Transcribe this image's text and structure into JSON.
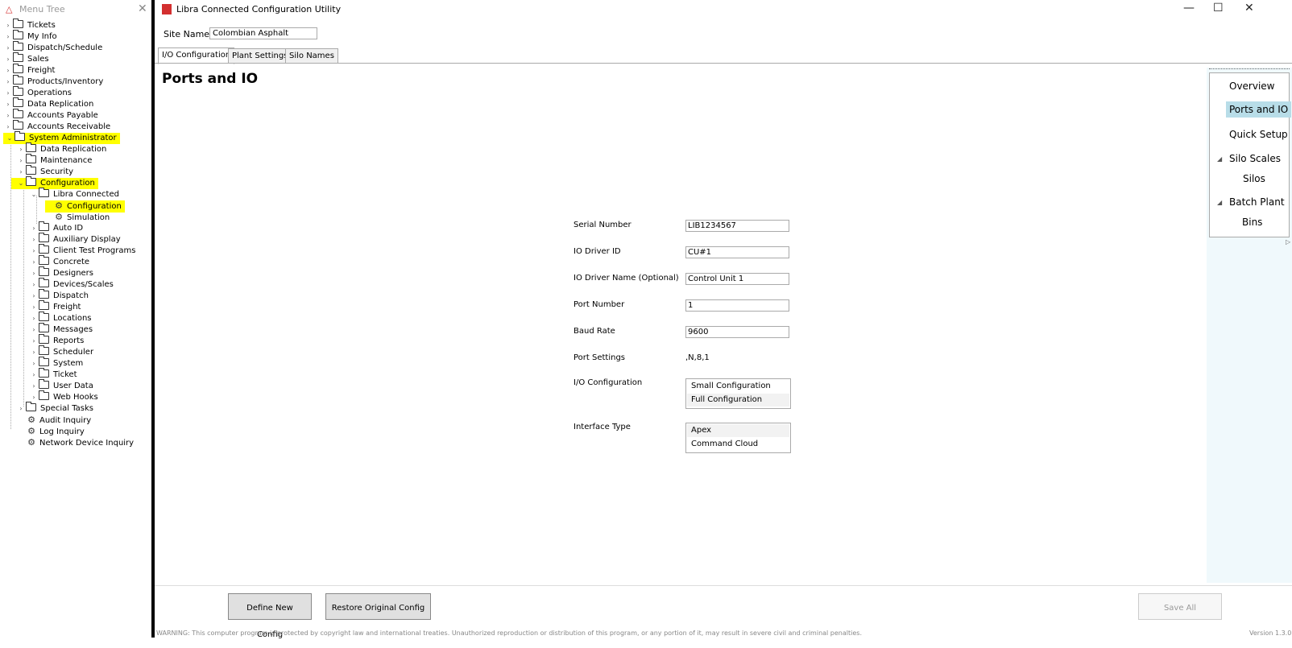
{
  "tree": {
    "title": "Menu Tree",
    "items": [
      {
        "label": "Tickets"
      },
      {
        "label": "My Info"
      },
      {
        "label": "Dispatch/Schedule"
      },
      {
        "label": "Sales"
      },
      {
        "label": "Freight"
      },
      {
        "label": "Products/Inventory"
      },
      {
        "label": "Operations"
      },
      {
        "label": "Data Replication"
      },
      {
        "label": "Accounts Payable"
      },
      {
        "label": "Accounts Receivable"
      },
      {
        "label": "System Administrator"
      },
      {
        "label": "Data Replication"
      },
      {
        "label": "Maintenance"
      },
      {
        "label": "Security"
      },
      {
        "label": "Configuration"
      },
      {
        "label": "Libra Connected"
      },
      {
        "label": "Configuration"
      },
      {
        "label": "Simulation"
      },
      {
        "label": "Auto ID"
      },
      {
        "label": "Auxiliary Display"
      },
      {
        "label": "Client Test Programs"
      },
      {
        "label": "Concrete"
      },
      {
        "label": "Designers"
      },
      {
        "label": "Devices/Scales"
      },
      {
        "label": "Dispatch"
      },
      {
        "label": "Freight"
      },
      {
        "label": "Locations"
      },
      {
        "label": "Messages"
      },
      {
        "label": "Reports"
      },
      {
        "label": "Scheduler"
      },
      {
        "label": "System"
      },
      {
        "label": "Ticket"
      },
      {
        "label": "User Data"
      },
      {
        "label": "Web Hooks"
      },
      {
        "label": "Special Tasks"
      },
      {
        "label": "Audit Inquiry"
      },
      {
        "label": "Log Inquiry"
      },
      {
        "label": "Network Device Inquiry"
      }
    ]
  },
  "window": {
    "title": "Libra Connected Configuration Utility",
    "app_icon_text": "Libra"
  },
  "site": {
    "label": "Site Name",
    "value": "Colombian Asphalt"
  },
  "tabs": [
    {
      "label": "I/O Configuration",
      "active": true
    },
    {
      "label": "Plant Settings"
    },
    {
      "label": "Silo Names"
    }
  ],
  "page": {
    "heading": "Ports and IO"
  },
  "nav": {
    "items": [
      {
        "label": "Overview"
      },
      {
        "label": "Ports and IO",
        "selected": true
      },
      {
        "label": "Quick Setup"
      },
      {
        "label": "Silo Scales"
      },
      {
        "label": "Silos"
      },
      {
        "label": "Batch Plant"
      },
      {
        "label": "Bins"
      }
    ]
  },
  "form": {
    "serial_number": {
      "label": "Serial Number",
      "value": "LIB1234567"
    },
    "io_driver_id": {
      "label": "IO Driver ID",
      "value": "CU#1"
    },
    "io_driver_name": {
      "label": "IO Driver Name (Optional)",
      "value": "Control Unit 1"
    },
    "port_number": {
      "label": "Port Number",
      "value": "1"
    },
    "baud_rate": {
      "label": "Baud Rate",
      "value": "9600"
    },
    "port_settings": {
      "label": "Port Settings",
      "value": ",N,8,1"
    },
    "io_configuration": {
      "label": "I/O Configuration",
      "options": [
        "Small Configuration",
        "Full Configuration"
      ],
      "selected": "Full Configuration"
    },
    "interface_type": {
      "label": "Interface Type",
      "options": [
        "Apex",
        "Command Cloud"
      ],
      "selected": "Apex"
    }
  },
  "buttons": {
    "define_new": "Define New Config",
    "restore": "Restore Original Config",
    "save_all": "Save All"
  },
  "footer": {
    "warning": "WARNING: This computer program is protected by copyright law and international treaties. Unauthorized reproduction or distribution of this program, or any portion of it, may result in severe civil and criminal penalties.",
    "version": "Version 1.3.0.0"
  },
  "colors": {
    "highlight": "#ffff00",
    "nav_selected": "#b8dde8",
    "nav_background": "#f0f9fc",
    "app_icon": "#d32f2f"
  }
}
